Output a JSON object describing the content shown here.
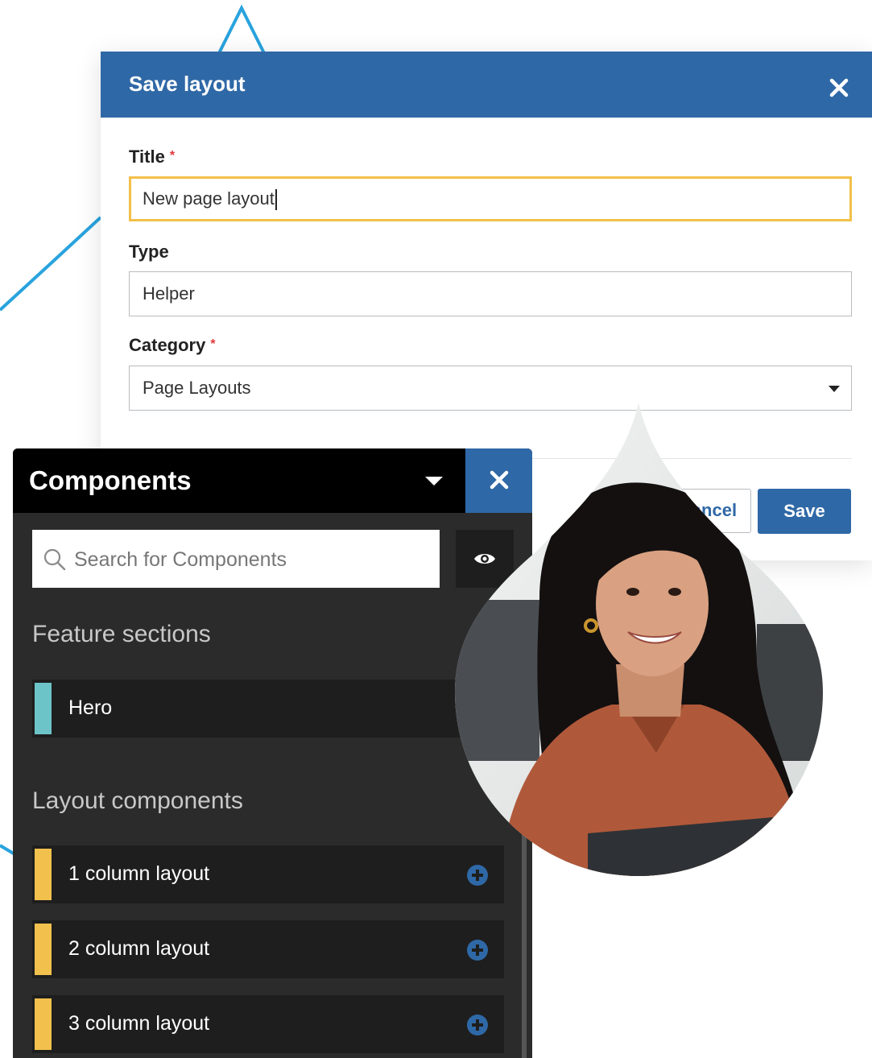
{
  "modal": {
    "title": "Save layout",
    "close_icon": "close-icon",
    "fields": {
      "title_label": "Title",
      "title_value": "New page layout",
      "type_label": "Type",
      "type_value": "Helper",
      "category_label": "Category",
      "category_value": "Page Layouts",
      "required_mark": "*"
    },
    "cancel_label": "Cancel",
    "save_label": "Save"
  },
  "components_panel": {
    "title": "Components",
    "search_placeholder": "Search for Components",
    "sections": [
      {
        "title": "Feature sections",
        "items": [
          {
            "label": "Hero",
            "color": "#6dc4c8"
          }
        ]
      },
      {
        "title": "Layout components",
        "items": [
          {
            "label": "1 column layout",
            "color": "#f1c04d"
          },
          {
            "label": "2 column layout",
            "color": "#f1c04d"
          },
          {
            "label": "3 column layout",
            "color": "#f1c04d"
          }
        ]
      }
    ]
  },
  "colors": {
    "primary": "#2f68a6",
    "focus": "#f3c04a",
    "required": "#e0373a",
    "panel_bg": "#2b2b2b",
    "accent_line": "#29a3dd"
  }
}
